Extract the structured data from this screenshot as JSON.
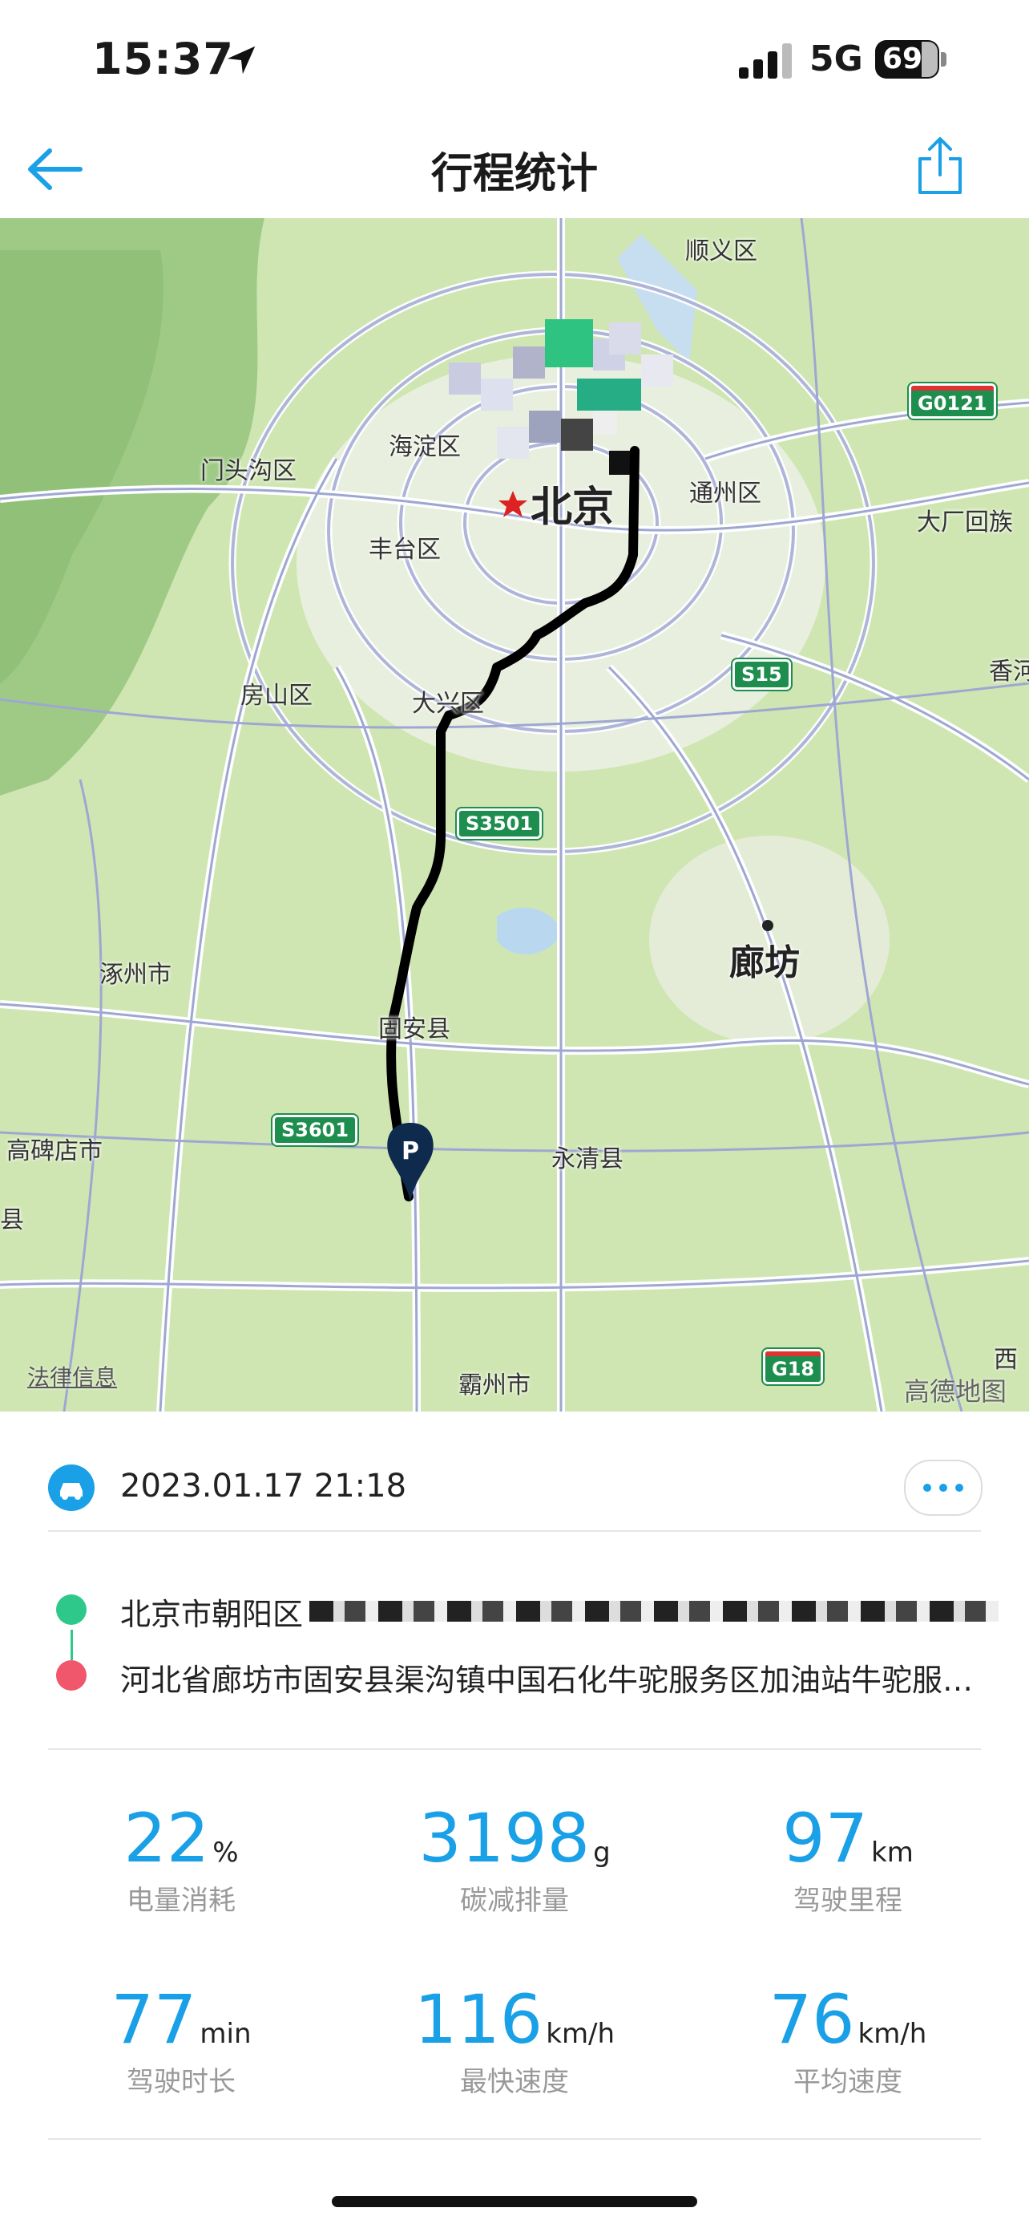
{
  "status_bar": {
    "time": "15:37",
    "network": "5G",
    "battery": "69"
  },
  "nav": {
    "title": "行程统计",
    "back_icon": "back-arrow-icon",
    "share_icon": "share-icon"
  },
  "map": {
    "labels": {
      "shunyi": "顺义区",
      "haidian": "海淀区",
      "mentougou": "门头沟区",
      "beijing": "北京",
      "tongzhou": "通州区",
      "dachang": "大厂回族",
      "fengtai": "丰台区",
      "xiang": "香河",
      "fangshan": "房山区",
      "daxing": "大兴区",
      "zhuozhou": "涿州市",
      "langfang": "廊坊",
      "gu_an": "固安县",
      "gaobeidian": "高碑店市",
      "yongqing": "永清县",
      "xian": "县",
      "bazhou": "霸州市",
      "xi": "西"
    },
    "shields": {
      "g0121": "G0121",
      "s15": "S15",
      "s3501": "S3501",
      "s3601": "S3601",
      "g18": "G18"
    },
    "parking_marker": "P",
    "attribution_left": "法律信息",
    "attribution_right": "高德地图"
  },
  "trip": {
    "datetime": "2023.01.17 21:18",
    "start": "北京市朝阳区",
    "end": "河北省廊坊市固安县渠沟镇中国石化牛驼服务区加油站牛驼服务区",
    "colors": {
      "start": "#2ec98a",
      "end": "#f0566c",
      "accent": "#1aa0e6"
    }
  },
  "stats": [
    {
      "value": "22",
      "unit": "%",
      "label": "电量消耗"
    },
    {
      "value": "3198",
      "unit": "g",
      "label": "碳减排量"
    },
    {
      "value": "97",
      "unit": "km",
      "label": "驾驶里程"
    },
    {
      "value": "77",
      "unit": "min",
      "label": "驾驶时长"
    },
    {
      "value": "116",
      "unit": "km/h",
      "label": "最快速度"
    },
    {
      "value": "76",
      "unit": "km/h",
      "label": "平均速度"
    }
  ]
}
